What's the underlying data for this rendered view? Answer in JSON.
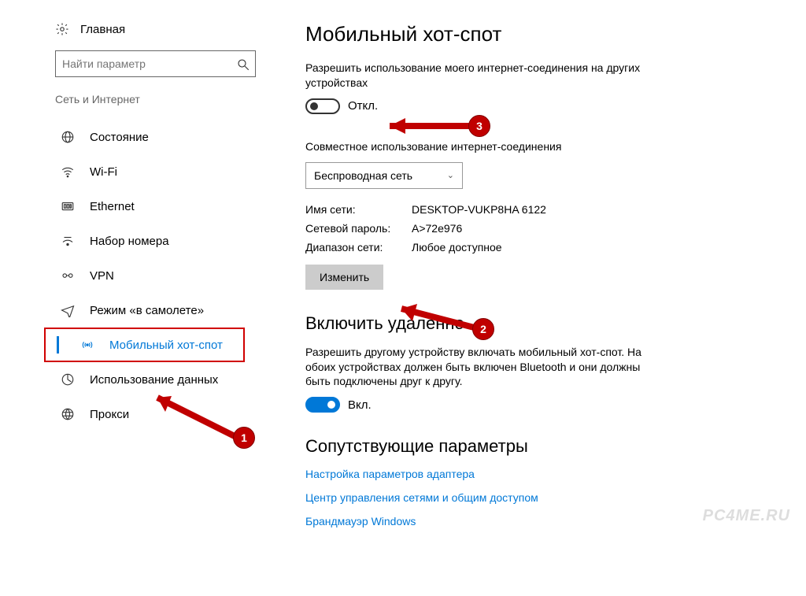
{
  "sidebar": {
    "home": "Главная",
    "search_placeholder": "Найти параметр",
    "section": "Сеть и Интернет",
    "items": [
      {
        "label": "Состояние"
      },
      {
        "label": "Wi-Fi"
      },
      {
        "label": "Ethernet"
      },
      {
        "label": "Набор номера"
      },
      {
        "label": "VPN"
      },
      {
        "label": "Режим «в самолете»"
      },
      {
        "label": "Мобильный хот-спот"
      },
      {
        "label": "Использование данных"
      },
      {
        "label": "Прокси"
      }
    ]
  },
  "main": {
    "title": "Мобильный хот-спот",
    "share_desc": "Разрешить использование моего интернет-соединения на других устройствах",
    "toggle_off": "Откл.",
    "share_from_label": "Совместное использование интернет-соединения",
    "share_from_value": "Беспроводная сеть",
    "net_name_k": "Имя сети:",
    "net_name_v": "DESKTOP-VUKP8HA 6122",
    "net_pass_k": "Сетевой пароль:",
    "net_pass_v": "A>72e976",
    "net_band_k": "Диапазон сети:",
    "net_band_v": "Любое доступное",
    "edit_btn": "Изменить",
    "remote_title": "Включить удаленно",
    "remote_desc": "Разрешить другому устройству включать мобильный хот-спот. На обоих устройствах должен быть включен Bluetooth и они должны быть подключены друг к другу.",
    "toggle_on": "Вкл.",
    "related_title": "Сопутствующие параметры",
    "link1": "Настройка параметров адаптера",
    "link2": "Центр управления сетями и общим доступом",
    "link3": "Брандмауэр Windows"
  },
  "annotations": {
    "b1": "1",
    "b2": "2",
    "b3": "3"
  },
  "watermark": "PC4ME.RU"
}
